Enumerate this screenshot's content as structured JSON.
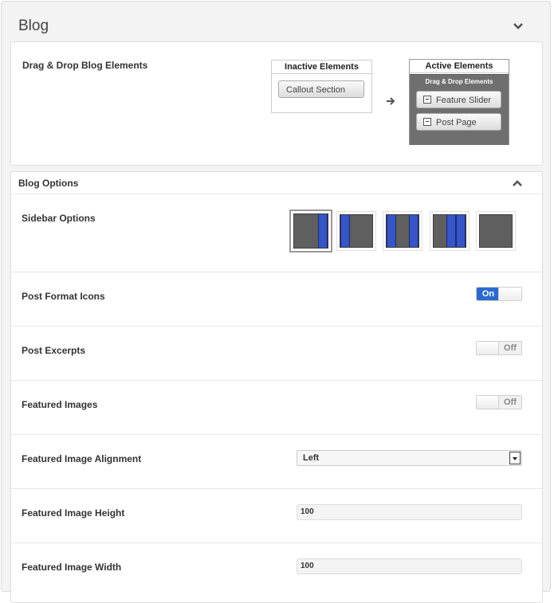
{
  "header": {
    "title": "Blog"
  },
  "drag_drop": {
    "label": "Drag & Drop Blog Elements",
    "inactive": {
      "title": "Inactive Elements",
      "items": [
        "Callout Section"
      ]
    },
    "active": {
      "title": "Active Elements",
      "subtitle": "Drag & Drop Elements",
      "items": [
        "Feature Slider",
        "Post Page"
      ]
    }
  },
  "blog_options": {
    "title": "Blog Options",
    "sidebar_label": "Sidebar Options",
    "post_format_icons": {
      "label": "Post Format Icons",
      "state": "On"
    },
    "post_excerpts": {
      "label": "Post Excerpts",
      "state": "Off"
    },
    "featured_images": {
      "label": "Featured Images",
      "state": "Off"
    },
    "featured_image_alignment": {
      "label": "Featured Image Alignment",
      "value": "Left"
    },
    "featured_image_height": {
      "label": "Featured Image Height",
      "value": "100"
    },
    "featured_image_width": {
      "label": "Featured Image Width",
      "value": "100"
    }
  },
  "colors": {
    "accent": "#2b6bd0",
    "sidebar_bar": "#3555c9"
  }
}
